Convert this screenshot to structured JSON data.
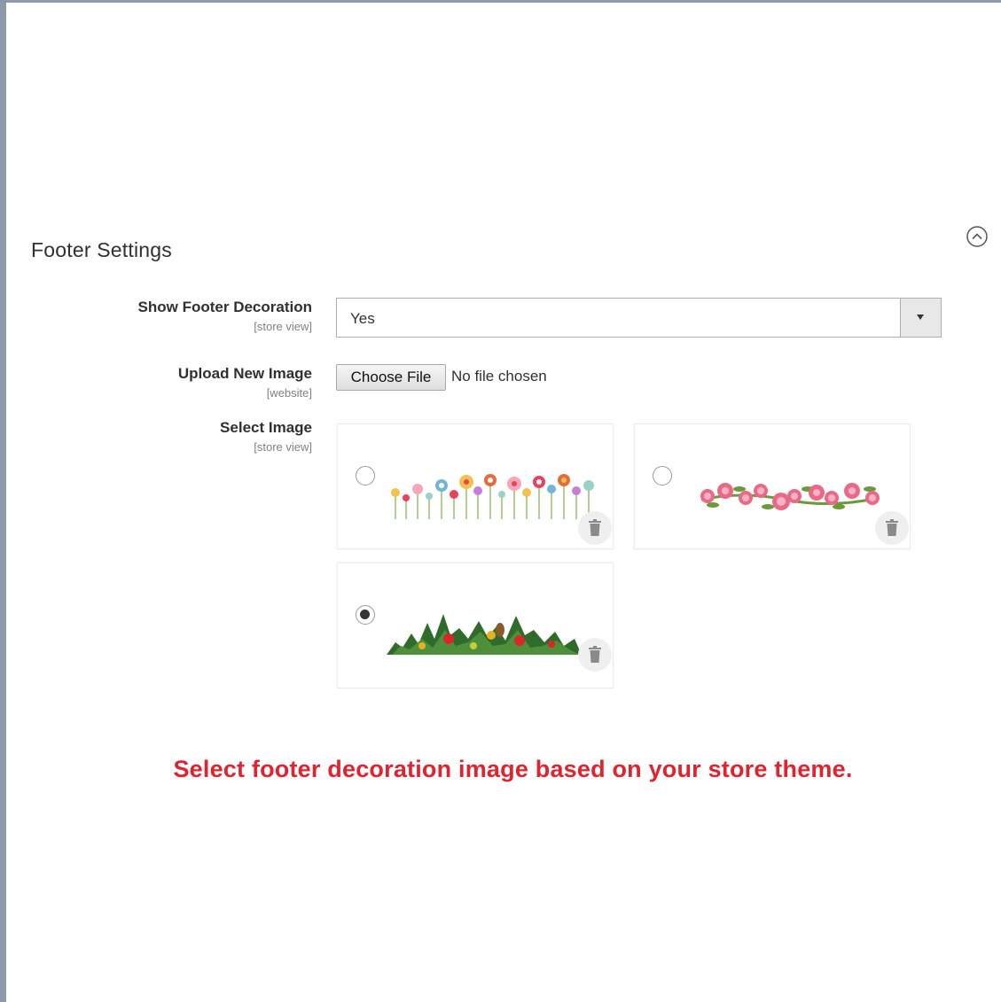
{
  "section": {
    "title": "Footer Settings",
    "collapse_icon": "chevron-up-circle-icon"
  },
  "fields": {
    "show_decoration": {
      "label": "Show Footer Decoration",
      "scope": "[store view]",
      "value": "Yes"
    },
    "upload_image": {
      "label": "Upload New Image",
      "scope": "[website]",
      "button_label": "Choose File",
      "status": "No file chosen"
    },
    "select_image": {
      "label": "Select Image",
      "scope": "[store view]",
      "options": [
        {
          "image": "colorful-flowers-border",
          "checked": false,
          "delete_icon": "trash-icon"
        },
        {
          "image": "pink-roses-garland",
          "checked": false,
          "delete_icon": "trash-icon"
        },
        {
          "image": "christmas-pine-garland",
          "checked": true,
          "delete_icon": "trash-icon"
        }
      ]
    }
  },
  "note": "Select footer decoration image based on your store theme.",
  "colors": {
    "note": "#e0242f",
    "frame": "#8a9aa8",
    "label": "#303030"
  }
}
